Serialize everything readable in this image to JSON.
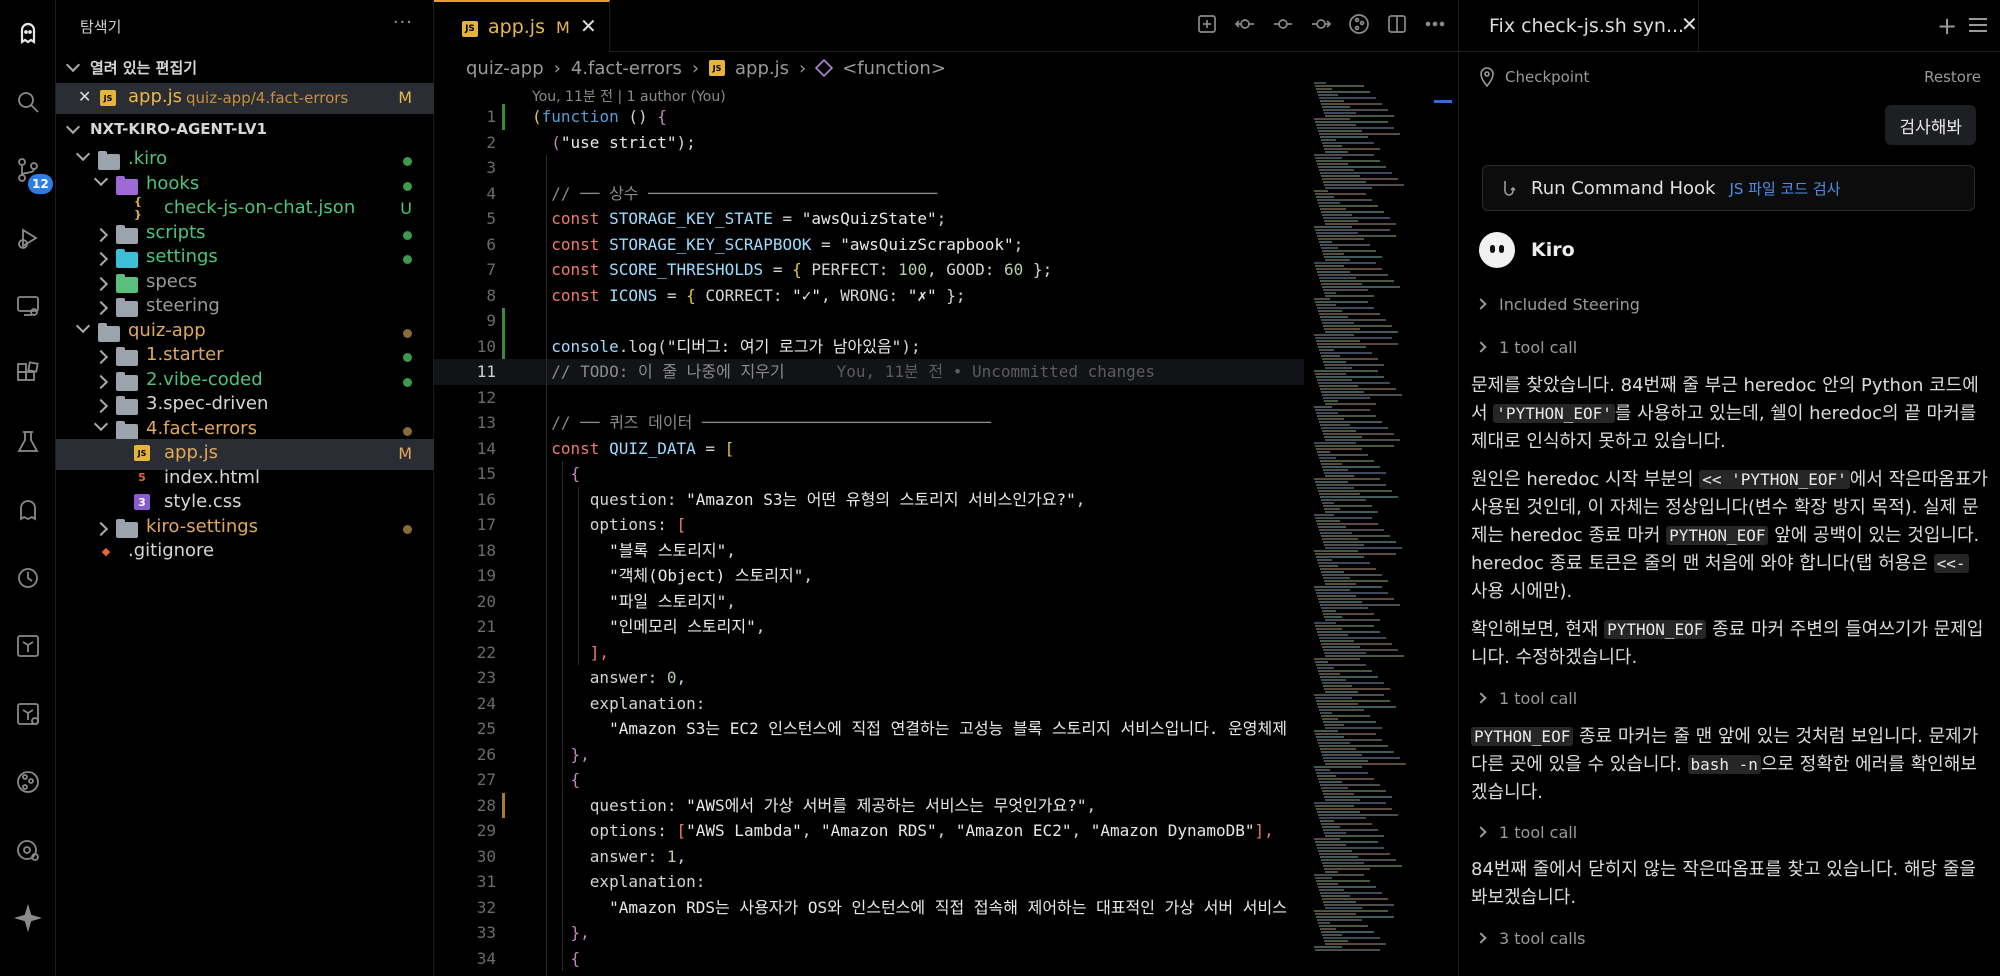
{
  "activity_bar": {
    "items": [
      "kiro-logo-icon",
      "search-icon",
      "source-control-icon",
      "run-debug-icon",
      "remote-explorer-icon",
      "extensions-icon",
      "testing-icon",
      "ghost-icon",
      "kiro-hooks-icon",
      "terraform-icon",
      "terraform-cloud-icon",
      "git-graph-icon",
      "git-history-icon",
      "sparkle-icon"
    ],
    "source_control_badge": "12"
  },
  "sidebar": {
    "title": "탐색기",
    "more": "···",
    "open_editors": {
      "label": "열려 있는 편집기",
      "items": [
        {
          "name": "app.js",
          "path": "quiz-app/4.fact-errors",
          "status": "M"
        }
      ]
    },
    "workspace": "NXT-KIRO-AGENT-LV1",
    "tree": [
      {
        "label": ".kiro",
        "status": "",
        "color": "#4ec37a"
      },
      {
        "label": "hooks",
        "status": "",
        "color": "#4ec37a"
      },
      {
        "label": "check-js-on-chat.json",
        "status": "U",
        "color": "#4ec37a"
      },
      {
        "label": "scripts",
        "status": "",
        "color": "#4ec37a"
      },
      {
        "label": "settings",
        "status": "",
        "color": "#4ec37a"
      },
      {
        "label": "specs",
        "status": "",
        "color": "#9a9a9a"
      },
      {
        "label": "steering",
        "status": "",
        "color": "#9a9a9a"
      },
      {
        "label": "quiz-app",
        "status": "",
        "color": "#e0a85a"
      },
      {
        "label": "1.starter",
        "status": "",
        "color": "#e0a85a"
      },
      {
        "label": "2.vibe-coded",
        "status": "",
        "color": "#4ec37a"
      },
      {
        "label": "3.spec-driven",
        "status": "",
        "color": "#d7d7d7"
      },
      {
        "label": "4.fact-errors",
        "status": "",
        "color": "#e0a85a"
      },
      {
        "label": "app.js",
        "status": "M",
        "color": "#e0a85a"
      },
      {
        "label": "index.html",
        "status": "",
        "color": "#d7d7d7"
      },
      {
        "label": "style.css",
        "status": "",
        "color": "#d7d7d7"
      },
      {
        "label": "kiro-settings",
        "status": "",
        "color": "#e0a85a"
      },
      {
        "label": ".gitignore",
        "status": "",
        "color": "#d7d7d7"
      }
    ]
  },
  "editor": {
    "tab": {
      "js_badge": "JS",
      "name": "app.js",
      "status": "M",
      "close": "✕"
    },
    "breadcrumb": [
      "quiz-app",
      "4.fact-errors",
      "app.js",
      "<function>"
    ],
    "blame_header": "You, 11분 전 | 1 author (You)",
    "inline_blame": "You, 11분 전 • Uncommitted changes",
    "lines": [
      [
        {
          "t": "(",
          "c": "#e8c547"
        },
        {
          "t": "function",
          "c": "#569cd6"
        },
        {
          "t": " () ",
          "c": "#d4d4d4"
        },
        {
          "t": "{",
          "c": "#c586c0"
        }
      ],
      [
        {
          "t": "  (",
          "c": "#c586c0"
        },
        {
          "t": "\"use strict\"",
          "c": "#e8e8e8"
        },
        {
          "t": ");",
          "c": "#d4d4d4"
        }
      ],
      [],
      [
        {
          "t": "  // ── 상수 ──────────────────────────────",
          "c": "#8a8a8a"
        }
      ],
      [
        {
          "t": "  const ",
          "c": "#f07a6a"
        },
        {
          "t": "STORAGE_KEY_STATE",
          "c": "#9cdcfe"
        },
        {
          "t": " = ",
          "c": "#d4d4d4"
        },
        {
          "t": "\"awsQuizState\"",
          "c": "#e8e8e8"
        },
        {
          "t": ";",
          "c": "#d4d4d4"
        }
      ],
      [
        {
          "t": "  const ",
          "c": "#f07a6a"
        },
        {
          "t": "STORAGE_KEY_SCRAPBOOK",
          "c": "#9cdcfe"
        },
        {
          "t": " = ",
          "c": "#d4d4d4"
        },
        {
          "t": "\"awsQuizScrapbook\"",
          "c": "#e8e8e8"
        },
        {
          "t": ";",
          "c": "#d4d4d4"
        }
      ],
      [
        {
          "t": "  const ",
          "c": "#f07a6a"
        },
        {
          "t": "SCORE_THRESHOLDS",
          "c": "#9cdcfe"
        },
        {
          "t": " = ",
          "c": "#d4d4d4"
        },
        {
          "t": "{",
          "c": "#e8c547"
        },
        {
          "t": " PERFECT: ",
          "c": "#d4d4d4"
        },
        {
          "t": "100",
          "c": "#b5cea8"
        },
        {
          "t": ", GOOD: ",
          "c": "#d4d4d4"
        },
        {
          "t": "60",
          "c": "#b5cea8"
        },
        {
          "t": " };",
          "c": "#d4d4d4"
        }
      ],
      [
        {
          "t": "  const ",
          "c": "#f07a6a"
        },
        {
          "t": "ICONS",
          "c": "#9cdcfe"
        },
        {
          "t": " = ",
          "c": "#d4d4d4"
        },
        {
          "t": "{",
          "c": "#e8c547"
        },
        {
          "t": " CORRECT: ",
          "c": "#d4d4d4"
        },
        {
          "t": "\"✓\"",
          "c": "#e8e8e8"
        },
        {
          "t": ", WRONG: ",
          "c": "#d4d4d4"
        },
        {
          "t": "\"✗\"",
          "c": "#e8e8e8"
        },
        {
          "t": " };",
          "c": "#d4d4d4"
        }
      ],
      [],
      [
        {
          "t": "  console",
          "c": "#9cdcfe"
        },
        {
          "t": ".log(",
          "c": "#d4d4d4"
        },
        {
          "t": "\"디버그: 여기 로그가 남아있음\"",
          "c": "#e8e8e8"
        },
        {
          "t": ");",
          "c": "#d4d4d4"
        }
      ],
      [
        {
          "t": "  // TODO: 이 줄 나중에 지우기",
          "c": "#8a8a8a"
        }
      ],
      [],
      [
        {
          "t": "  // ── 퀴즈 데이터 ──────────────────────────────",
          "c": "#8a8a8a"
        }
      ],
      [
        {
          "t": "  const ",
          "c": "#f07a6a"
        },
        {
          "t": "QUIZ_DATA",
          "c": "#9cdcfe"
        },
        {
          "t": " = ",
          "c": "#d4d4d4"
        },
        {
          "t": "[",
          "c": "#e8c547"
        }
      ],
      [
        {
          "t": "    {",
          "c": "#c586c0"
        }
      ],
      [
        {
          "t": "      question: ",
          "c": "#d4d4d4"
        },
        {
          "t": "\"Amazon S3는 어떤 유형의 스토리지 서비스인가요?\"",
          "c": "#e8e8e8"
        },
        {
          "t": ",",
          "c": "#d4d4d4"
        }
      ],
      [
        {
          "t": "      options: ",
          "c": "#d4d4d4"
        },
        {
          "t": "[",
          "c": "#f07a6a"
        }
      ],
      [
        {
          "t": "        \"블록 스토리지\"",
          "c": "#e8e8e8"
        },
        {
          "t": ",",
          "c": "#d4d4d4"
        }
      ],
      [
        {
          "t": "        \"객체(Object) 스토리지\"",
          "c": "#e8e8e8"
        },
        {
          "t": ",",
          "c": "#d4d4d4"
        }
      ],
      [
        {
          "t": "        \"파일 스토리지\"",
          "c": "#e8e8e8"
        },
        {
          "t": ",",
          "c": "#d4d4d4"
        }
      ],
      [
        {
          "t": "        \"인메모리 스토리지\"",
          "c": "#e8e8e8"
        },
        {
          "t": ",",
          "c": "#d4d4d4"
        }
      ],
      [
        {
          "t": "      ],",
          "c": "#f07a6a"
        }
      ],
      [
        {
          "t": "      answer: ",
          "c": "#d4d4d4"
        },
        {
          "t": "0",
          "c": "#b5cea8"
        },
        {
          "t": ",",
          "c": "#d4d4d4"
        }
      ],
      [
        {
          "t": "      explanation:",
          "c": "#d4d4d4"
        }
      ],
      [
        {
          "t": "        \"Amazon S3는 EC2 인스턴스에 직접 연결하는 고성능 블록 스토리지 서비스입니다. 운영체제",
          "c": "#e8e8e8"
        }
      ],
      [
        {
          "t": "    },",
          "c": "#c586c0"
        }
      ],
      [
        {
          "t": "    {",
          "c": "#c586c0"
        }
      ],
      [
        {
          "t": "      question: ",
          "c": "#d4d4d4"
        },
        {
          "t": "\"AWS에서 가상 서버를 제공하는 서비스는 무엇인가요?\"",
          "c": "#e8e8e8"
        },
        {
          "t": ",",
          "c": "#d4d4d4"
        }
      ],
      [
        {
          "t": "      options: ",
          "c": "#d4d4d4"
        },
        {
          "t": "[",
          "c": "#f07a6a"
        },
        {
          "t": "\"AWS Lambda\"",
          "c": "#e8e8e8"
        },
        {
          "t": ", ",
          "c": "#d4d4d4"
        },
        {
          "t": "\"Amazon RDS\"",
          "c": "#e8e8e8"
        },
        {
          "t": ", ",
          "c": "#d4d4d4"
        },
        {
          "t": "\"Amazon EC2\"",
          "c": "#e8e8e8"
        },
        {
          "t": ", ",
          "c": "#d4d4d4"
        },
        {
          "t": "\"Amazon DynamoDB\"",
          "c": "#e8e8e8"
        },
        {
          "t": "],",
          "c": "#f07a6a"
        }
      ],
      [
        {
          "t": "      answer: ",
          "c": "#d4d4d4"
        },
        {
          "t": "1",
          "c": "#b5cea8"
        },
        {
          "t": ",",
          "c": "#d4d4d4"
        }
      ],
      [
        {
          "t": "      explanation:",
          "c": "#d4d4d4"
        }
      ],
      [
        {
          "t": "        \"Amazon RDS는 사용자가 OS와 인스턴스에 직접 접속해 제어하는 대표적인 가상 서버 서비스",
          "c": "#e8e8e8"
        }
      ],
      [
        {
          "t": "    },",
          "c": "#c586c0"
        }
      ],
      [
        {
          "t": "    {",
          "c": "#c586c0"
        }
      ]
    ]
  },
  "chat": {
    "tab_title": "Fix check-js.sh syn...",
    "checkpoint": "Checkpoint",
    "restore": "Restore",
    "user_message": "검사해봐",
    "hook_label": "Run Command Hook",
    "hook_sub": "JS 파일 코드 검사",
    "agent_name": "Kiro",
    "included_steering": "Included Steering",
    "tool_call_1": "1 tool call",
    "p1": "문제를 찾았습니다. 84번째 줄 부근 heredoc 안의 Python 코드에서 {c}'PYTHON_EOF'{/c}를 사용하고 있는데, 쉘이 heredoc의 끝 마커를 제대로 인식하지 못하고 있습니다.",
    "p2": "원인은 heredoc 시작 부분의 {c}<< 'PYTHON_EOF'{/c}에서 작은따옴표가 사용된 것인데, 이 자체는 정상입니다(변수 확장 방지 목적). 실제 문제는 heredoc 종료 마커 {c}PYTHON_EOF{/c} 앞에 공백이 있는 것입니다. heredoc 종료 토큰은 줄의 맨 처음에 와야 합니다(탭 허용은 {c}<<-{/c} 사용 시에만).",
    "p3": "확인해보면, 현재 {c}PYTHON_EOF{/c} 종료 마커 주변의 들여쓰기가 문제입니다. 수정하겠습니다.",
    "tool_call_2": "1 tool call",
    "p4": "{c}PYTHON_EOF{/c} 종료 마커는 줄 맨 앞에 있는 것처럼 보입니다. 문제가 다른 곳에 있을 수 있습니다. {c}bash -n{/c}으로 정확한 에러를 확인해보겠습니다.",
    "tool_call_3": "1 tool call",
    "p5": "84번째 줄에서 닫히지 않는 작은따옴표를 찾고 있습니다. 해당 줄을 봐보겠습니다.",
    "tool_call_4": "3 tool calls"
  }
}
